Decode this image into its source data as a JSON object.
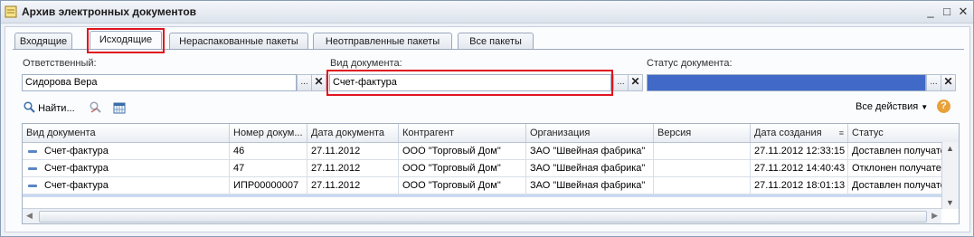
{
  "window": {
    "title": "Архив электронных документов",
    "minimize": "_",
    "maximize": "□",
    "close": "✕"
  },
  "tabs": [
    {
      "label": "Входящие"
    },
    {
      "label": "Исходящие"
    },
    {
      "label": "Нераспакованные пакеты"
    },
    {
      "label": "Неотправленные пакеты"
    },
    {
      "label": "Все пакеты"
    }
  ],
  "filters": {
    "responsible": {
      "label": "Ответственный:",
      "value": "Сидорова Вера"
    },
    "doc_type": {
      "label": "Вид документа:",
      "value": "Счет-фактура"
    },
    "doc_status": {
      "label": "Статус документа:",
      "value": ""
    },
    "select_btn": "...",
    "clear_btn": "✕"
  },
  "toolbar": {
    "find_label": "Найти...",
    "all_actions_label": "Все действия",
    "help": "?"
  },
  "table": {
    "columns": [
      "Вид документа",
      "Номер докум...",
      "Дата документа",
      "Контрагент",
      "Организация",
      "Версия",
      "Дата создания",
      "Статус"
    ],
    "rows": [
      [
        "Счет-фактура",
        "46",
        "27.11.2012",
        "ООО \"Торговый Дом\"",
        "ЗАО \"Швейная фабрика\"",
        "",
        "27.11.2012 12:33:15",
        "Доставлен получате"
      ],
      [
        "Счет-фактура",
        "47",
        "27.11.2012",
        "ООО \"Торговый Дом\"",
        "ЗАО \"Швейная фабрика\"",
        "",
        "27.11.2012 14:40:43",
        "Отклонен получате"
      ],
      [
        "Счет-фактура",
        "ИПР00000007",
        "27.11.2012",
        "ООО \"Торговый Дом\"",
        "ЗАО \"Швейная фабрика\"",
        "",
        "27.11.2012 18:01:13",
        "Доставлен получате"
      ]
    ]
  },
  "colors": {
    "highlight": "#e0151e",
    "status_fill": "#4169c8"
  }
}
